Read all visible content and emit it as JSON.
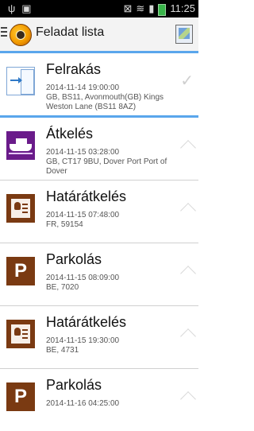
{
  "status_bar": {
    "left_icons": [
      "usb-icon",
      "image-icon"
    ],
    "time": "11:25"
  },
  "actionbar": {
    "title": "Feladat lista"
  },
  "tasks": [
    {
      "name": "Felrakás",
      "meta": "2014-11-14 19:00:00\nGB, BS11, Avonmouth(GB) Kings\nWeston Lane (BS11 8AZ)",
      "icon": "dropoff-icon"
    },
    {
      "name": "Átkelés",
      "meta": "2014-11-15 03:28:00\nGB, CT17 9BU, Dover Port Port of\nDover",
      "icon": "ferry-icon"
    },
    {
      "name": "Határátkelés",
      "meta": "2014-11-15 07:48:00\nFR, 59154",
      "icon": "border-crossing-icon"
    },
    {
      "name": "Parkolás",
      "meta": "2014-11-15 08:09:00\nBE, 7020",
      "icon": "parking-icon"
    },
    {
      "name": "Határátkelés",
      "meta": "2014-11-15 19:30:00\nBE, 4731",
      "icon": "border-crossing-icon"
    },
    {
      "name": "Parkolás",
      "meta": "2014-11-16 04:25:00",
      "icon": "parking-icon"
    }
  ]
}
